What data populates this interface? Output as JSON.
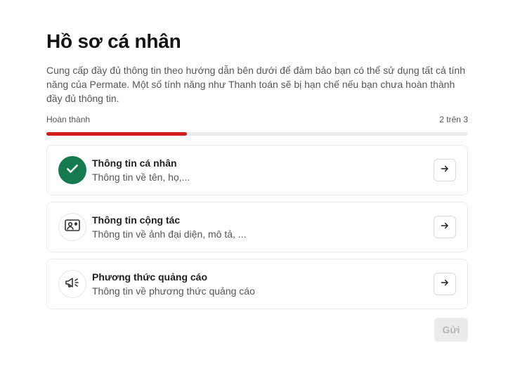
{
  "header": {
    "title": "Hồ sơ cá nhân",
    "description": "Cung cấp đầy đủ thông tin theo hướng dẫn bên dưới để đảm bảo bạn có thể sử dụng tất cả tính năng của Permate. Một số tính năng như Thanh toán sẽ bị hạn chế nếu bạn chưa hoàn thành đầy đủ thông tin."
  },
  "progress": {
    "label": "Hoàn thành",
    "count_text": "2 trên 3",
    "fraction": 0.333,
    "color": "#d21d1d"
  },
  "cards": [
    {
      "title": "Thông tin cá nhân",
      "subtitle": "Thông tin về tên, họ,...",
      "icon": "check-icon",
      "status": "completed"
    },
    {
      "title": "Thông tin cộng tác",
      "subtitle": "Thông tin về ảnh đại diện, mô tả, ...",
      "icon": "id-card-icon",
      "status": "pending"
    },
    {
      "title": "Phương thức quảng cáo",
      "subtitle": "Thông tin về phương thức quảng cáo",
      "icon": "megaphone-icon",
      "status": "pending"
    }
  ],
  "footer": {
    "submit_label": "Gửi"
  },
  "colors": {
    "accent": "#d21d1d",
    "success": "#157a4e"
  }
}
